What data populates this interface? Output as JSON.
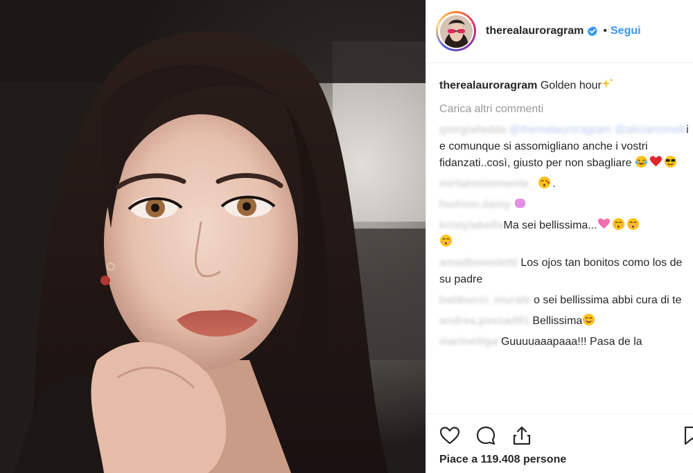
{
  "post": {
    "username": "therealauroragram",
    "dot": "•",
    "follow_label": "Segui"
  },
  "caption": {
    "username": "therealauroragram",
    "text": "Golden hour"
  },
  "load_more_label": "Carica altri commenti",
  "comments": [
    {
      "user": "giorgiafadda",
      "mention": "@therealauroragram @aliciamonelli",
      "text": "i e comunque si assomigliano anche i vostri fidanzati..così, giusto per non sbagliare"
    },
    {
      "user": "mirtalonimmente_",
      "text": "."
    },
    {
      "user": "fashion.daisy",
      "text": ""
    },
    {
      "user": "kristylabella",
      "text": "Ma sei bellissima..."
    },
    {
      "user": "amadbenedetti",
      "text": "Los ojos tan bonitos como los de su padre"
    },
    {
      "user": "babbucci_murale",
      "text": "o sei bellissima abbi cura di te"
    },
    {
      "user": "andrea.passad91",
      "text": "Bellissima"
    },
    {
      "user": "marinelliga",
      "text": "Guuuuaaapaaa!!! Pasa de la"
    }
  ],
  "likes_text": "Piace a 119.408 persone",
  "icons": {
    "like": "heart-icon",
    "comment": "comment-icon",
    "share": "share-icon",
    "save": "bookmark-icon"
  },
  "colors": {
    "link": "#3897f0",
    "muted": "#999999",
    "text": "#262626"
  }
}
